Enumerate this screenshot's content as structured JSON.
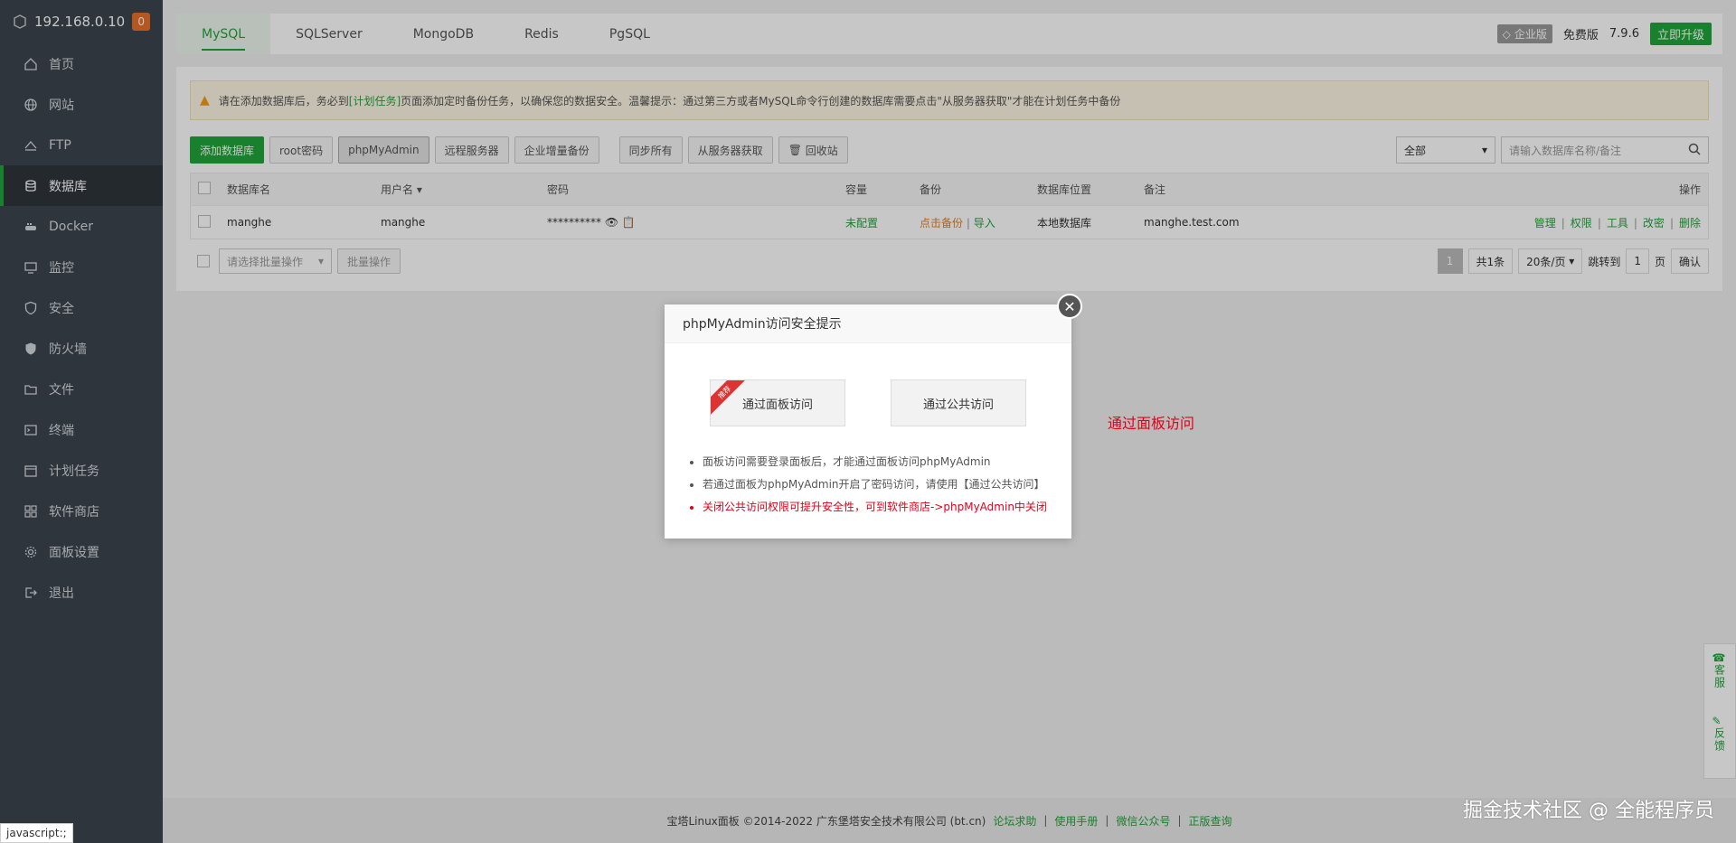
{
  "server": {
    "ip": "192.168.0.10",
    "badge": "0"
  },
  "sidebar": {
    "items": [
      {
        "label": "首页",
        "icon": "home-icon"
      },
      {
        "label": "网站",
        "icon": "globe-icon"
      },
      {
        "label": "FTP",
        "icon": "ftp-icon"
      },
      {
        "label": "数据库",
        "icon": "database-icon"
      },
      {
        "label": "Docker",
        "icon": "docker-icon"
      },
      {
        "label": "监控",
        "icon": "monitor-icon"
      },
      {
        "label": "安全",
        "icon": "shield-icon"
      },
      {
        "label": "防火墙",
        "icon": "firewall-icon"
      },
      {
        "label": "文件",
        "icon": "folder-icon"
      },
      {
        "label": "终端",
        "icon": "terminal-icon"
      },
      {
        "label": "计划任务",
        "icon": "clock-icon"
      },
      {
        "label": "软件商店",
        "icon": "apps-icon"
      },
      {
        "label": "面板设置",
        "icon": "gear-icon"
      },
      {
        "label": "退出",
        "icon": "logout-icon"
      }
    ]
  },
  "tabs": [
    "MySQL",
    "SQLServer",
    "MongoDB",
    "Redis",
    "PgSQL"
  ],
  "topright": {
    "enterprise": "企业版",
    "free": "免费版",
    "version": "7.9.6",
    "upgrade": "立即升级"
  },
  "notice": {
    "pre": "请在添加数据库后，务必到",
    "link": "[计划任务]",
    "post": "页面添加定时备份任务，以确保您的数据安全。温馨提示：通过第三方或者MySQL命令行创建的数据库需要点击\"从服务器获取\"才能在计划任务中备份"
  },
  "toolbar": {
    "add_db": "添加数据库",
    "root_pwd": "root密码",
    "phpmyadmin": "phpMyAdmin",
    "remote": "远程服务器",
    "incremental": "企业增量备份",
    "sync_all": "同步所有",
    "fetch": "从服务器获取",
    "recycle": "回收站",
    "filter": "全部",
    "search_placeholder": "请输入数据库名称/备注"
  },
  "table": {
    "headers": {
      "name": "数据库名",
      "user": "用户名",
      "pass": "密码",
      "cap": "容量",
      "bak": "备份",
      "loc": "数据库位置",
      "note": "备注",
      "ops": "操作"
    },
    "rows": [
      {
        "name": "manghe",
        "user": "manghe",
        "pass": "**********",
        "cap": "未配置",
        "bak": "点击备份",
        "import": "导入",
        "loc": "本地数据库",
        "note": "manghe.test.com",
        "ops": [
          "管理",
          "权限",
          "工具",
          "改密",
          "删除"
        ]
      }
    ]
  },
  "batch": {
    "placeholder": "请选择批量操作",
    "button": "批量操作"
  },
  "pager": {
    "current": "1",
    "total": "共1条",
    "per_page": "20条/页",
    "goto": "跳转到",
    "page_input": "1",
    "page_unit": "页",
    "confirm": "确认"
  },
  "modal": {
    "title": "phpMyAdmin访问安全提示",
    "panel_access": "通过面板访问",
    "public_access": "通过公共访问",
    "ribbon": "推荐",
    "tips": [
      "面板访问需要登录面板后，才能通过面板访问phpMyAdmin",
      "若通过面板为phpMyAdmin开启了密码访问，请使用【通过公共访问】",
      "关闭公共访问权限可提升安全性，可到软件商店->phpMyAdmin中关闭"
    ]
  },
  "side_hint": "通过面板访问",
  "footer": {
    "copyright": "宝塔Linux面板 ©2014-2022 广东堡塔安全技术有限公司 (bt.cn)",
    "links": [
      "论坛求助",
      "使用手册",
      "微信公众号",
      "正版查询"
    ]
  },
  "float_service": {
    "service": "客服",
    "feedback": "反馈"
  },
  "watermark": "掘金技术社区 @ 全能程序员",
  "status_bar": "javascript:;"
}
